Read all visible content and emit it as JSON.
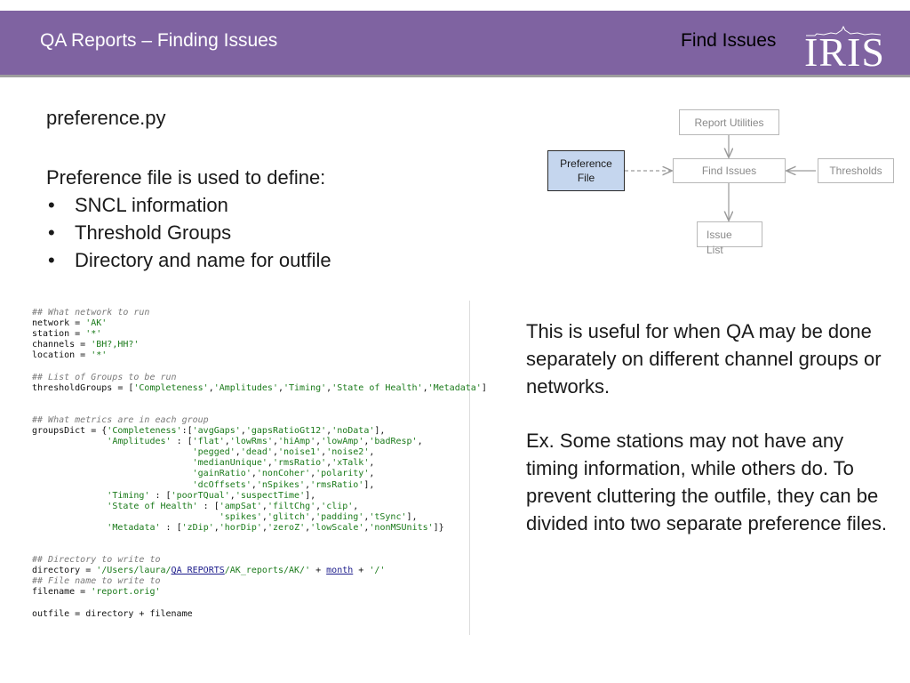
{
  "header": {
    "title": "QA Reports – Finding Issues",
    "section": "Find Issues",
    "logo_text": "IRIS"
  },
  "left": {
    "filename": "preference.py",
    "intro": "Preference file is used to define:",
    "bullets": [
      "SNCL information",
      "Threshold Groups",
      "Directory and name for outfile"
    ]
  },
  "diagram": {
    "report_utilities": "Report Utilities",
    "preference_file_line1": "Preference",
    "preference_file_line2": "File",
    "find_issues": "Find Issues",
    "thresholds": "Thresholds",
    "issue_list_line1": "Issue",
    "issue_list_line2": "List"
  },
  "code": {
    "lines": [
      "## What network to run",
      "network = 'AK'",
      "station = '*'",
      "channels = 'BH?,HH?'",
      "location = '*'",
      "",
      "## List of Groups to be run",
      "thresholdGroups = ['Completeness','Amplitudes','Timing','State of Health','Metadata']",
      "",
      "",
      "## What metrics are in each group",
      "groupsDict = {'Completeness':['avgGaps','gapsRatioGt12','noData'],",
      "              'Amplitudes' : ['flat','lowRms','hiAmp','lowAmp','badResp',",
      "                              'pegged','dead','noise1','noise2',",
      "                              'medianUnique','rmsRatio','xTalk',",
      "                              'gainRatio','nonCoher','polarity',",
      "                              'dcOffsets','nSpikes','rmsRatio'],",
      "              'Timing' : ['poorTQual','suspectTime'],",
      "              'State of Health' : ['ampSat','filtChg','clip',",
      "                                   'spikes','glitch','padding','tSync'],",
      "              'Metadata' : ['zDip','horDip','zeroZ','lowScale','nonMSUnits']}",
      "",
      "",
      "## Directory to write to",
      "directory = '/Users/laura/QA_REPORTS/AK_reports/AK/' + month + '/'",
      "## File name to write to",
      "filename = 'report.orig'",
      "",
      "outfile = directory + filename"
    ]
  },
  "right": {
    "paragraph1": "This is useful for when QA may be done separately on different channel groups or networks.",
    "paragraph2": "Ex. Some stations may not have any timing information, while others do. To prevent cluttering the outfile, they can be divided into two separate preference files."
  }
}
